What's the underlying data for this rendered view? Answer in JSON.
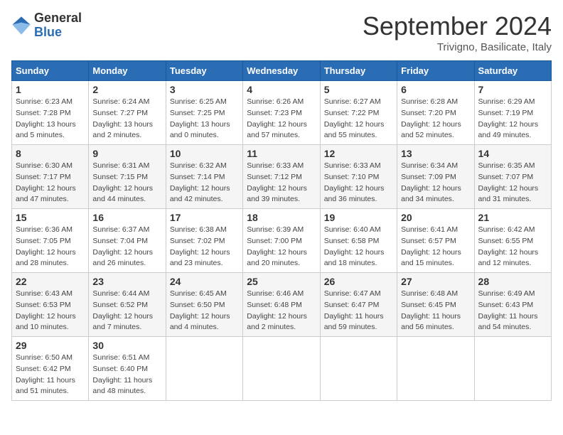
{
  "header": {
    "logo_general": "General",
    "logo_blue": "Blue",
    "month": "September 2024",
    "location": "Trivigno, Basilicate, Italy"
  },
  "weekdays": [
    "Sunday",
    "Monday",
    "Tuesday",
    "Wednesday",
    "Thursday",
    "Friday",
    "Saturday"
  ],
  "weeks": [
    [
      {
        "day": "1",
        "lines": [
          "Sunrise: 6:23 AM",
          "Sunset: 7:28 PM",
          "Daylight: 13 hours",
          "and 5 minutes."
        ]
      },
      {
        "day": "2",
        "lines": [
          "Sunrise: 6:24 AM",
          "Sunset: 7:27 PM",
          "Daylight: 13 hours",
          "and 2 minutes."
        ]
      },
      {
        "day": "3",
        "lines": [
          "Sunrise: 6:25 AM",
          "Sunset: 7:25 PM",
          "Daylight: 13 hours",
          "and 0 minutes."
        ]
      },
      {
        "day": "4",
        "lines": [
          "Sunrise: 6:26 AM",
          "Sunset: 7:23 PM",
          "Daylight: 12 hours",
          "and 57 minutes."
        ]
      },
      {
        "day": "5",
        "lines": [
          "Sunrise: 6:27 AM",
          "Sunset: 7:22 PM",
          "Daylight: 12 hours",
          "and 55 minutes."
        ]
      },
      {
        "day": "6",
        "lines": [
          "Sunrise: 6:28 AM",
          "Sunset: 7:20 PM",
          "Daylight: 12 hours",
          "and 52 minutes."
        ]
      },
      {
        "day": "7",
        "lines": [
          "Sunrise: 6:29 AM",
          "Sunset: 7:19 PM",
          "Daylight: 12 hours",
          "and 49 minutes."
        ]
      }
    ],
    [
      {
        "day": "8",
        "lines": [
          "Sunrise: 6:30 AM",
          "Sunset: 7:17 PM",
          "Daylight: 12 hours",
          "and 47 minutes."
        ]
      },
      {
        "day": "9",
        "lines": [
          "Sunrise: 6:31 AM",
          "Sunset: 7:15 PM",
          "Daylight: 12 hours",
          "and 44 minutes."
        ]
      },
      {
        "day": "10",
        "lines": [
          "Sunrise: 6:32 AM",
          "Sunset: 7:14 PM",
          "Daylight: 12 hours",
          "and 42 minutes."
        ]
      },
      {
        "day": "11",
        "lines": [
          "Sunrise: 6:33 AM",
          "Sunset: 7:12 PM",
          "Daylight: 12 hours",
          "and 39 minutes."
        ]
      },
      {
        "day": "12",
        "lines": [
          "Sunrise: 6:33 AM",
          "Sunset: 7:10 PM",
          "Daylight: 12 hours",
          "and 36 minutes."
        ]
      },
      {
        "day": "13",
        "lines": [
          "Sunrise: 6:34 AM",
          "Sunset: 7:09 PM",
          "Daylight: 12 hours",
          "and 34 minutes."
        ]
      },
      {
        "day": "14",
        "lines": [
          "Sunrise: 6:35 AM",
          "Sunset: 7:07 PM",
          "Daylight: 12 hours",
          "and 31 minutes."
        ]
      }
    ],
    [
      {
        "day": "15",
        "lines": [
          "Sunrise: 6:36 AM",
          "Sunset: 7:05 PM",
          "Daylight: 12 hours",
          "and 28 minutes."
        ]
      },
      {
        "day": "16",
        "lines": [
          "Sunrise: 6:37 AM",
          "Sunset: 7:04 PM",
          "Daylight: 12 hours",
          "and 26 minutes."
        ]
      },
      {
        "day": "17",
        "lines": [
          "Sunrise: 6:38 AM",
          "Sunset: 7:02 PM",
          "Daylight: 12 hours",
          "and 23 minutes."
        ]
      },
      {
        "day": "18",
        "lines": [
          "Sunrise: 6:39 AM",
          "Sunset: 7:00 PM",
          "Daylight: 12 hours",
          "and 20 minutes."
        ]
      },
      {
        "day": "19",
        "lines": [
          "Sunrise: 6:40 AM",
          "Sunset: 6:58 PM",
          "Daylight: 12 hours",
          "and 18 minutes."
        ]
      },
      {
        "day": "20",
        "lines": [
          "Sunrise: 6:41 AM",
          "Sunset: 6:57 PM",
          "Daylight: 12 hours",
          "and 15 minutes."
        ]
      },
      {
        "day": "21",
        "lines": [
          "Sunrise: 6:42 AM",
          "Sunset: 6:55 PM",
          "Daylight: 12 hours",
          "and 12 minutes."
        ]
      }
    ],
    [
      {
        "day": "22",
        "lines": [
          "Sunrise: 6:43 AM",
          "Sunset: 6:53 PM",
          "Daylight: 12 hours",
          "and 10 minutes."
        ]
      },
      {
        "day": "23",
        "lines": [
          "Sunrise: 6:44 AM",
          "Sunset: 6:52 PM",
          "Daylight: 12 hours",
          "and 7 minutes."
        ]
      },
      {
        "day": "24",
        "lines": [
          "Sunrise: 6:45 AM",
          "Sunset: 6:50 PM",
          "Daylight: 12 hours",
          "and 4 minutes."
        ]
      },
      {
        "day": "25",
        "lines": [
          "Sunrise: 6:46 AM",
          "Sunset: 6:48 PM",
          "Daylight: 12 hours",
          "and 2 minutes."
        ]
      },
      {
        "day": "26",
        "lines": [
          "Sunrise: 6:47 AM",
          "Sunset: 6:47 PM",
          "Daylight: 11 hours",
          "and 59 minutes."
        ]
      },
      {
        "day": "27",
        "lines": [
          "Sunrise: 6:48 AM",
          "Sunset: 6:45 PM",
          "Daylight: 11 hours",
          "and 56 minutes."
        ]
      },
      {
        "day": "28",
        "lines": [
          "Sunrise: 6:49 AM",
          "Sunset: 6:43 PM",
          "Daylight: 11 hours",
          "and 54 minutes."
        ]
      }
    ],
    [
      {
        "day": "29",
        "lines": [
          "Sunrise: 6:50 AM",
          "Sunset: 6:42 PM",
          "Daylight: 11 hours",
          "and 51 minutes."
        ]
      },
      {
        "day": "30",
        "lines": [
          "Sunrise: 6:51 AM",
          "Sunset: 6:40 PM",
          "Daylight: 11 hours",
          "and 48 minutes."
        ]
      },
      null,
      null,
      null,
      null,
      null
    ]
  ]
}
